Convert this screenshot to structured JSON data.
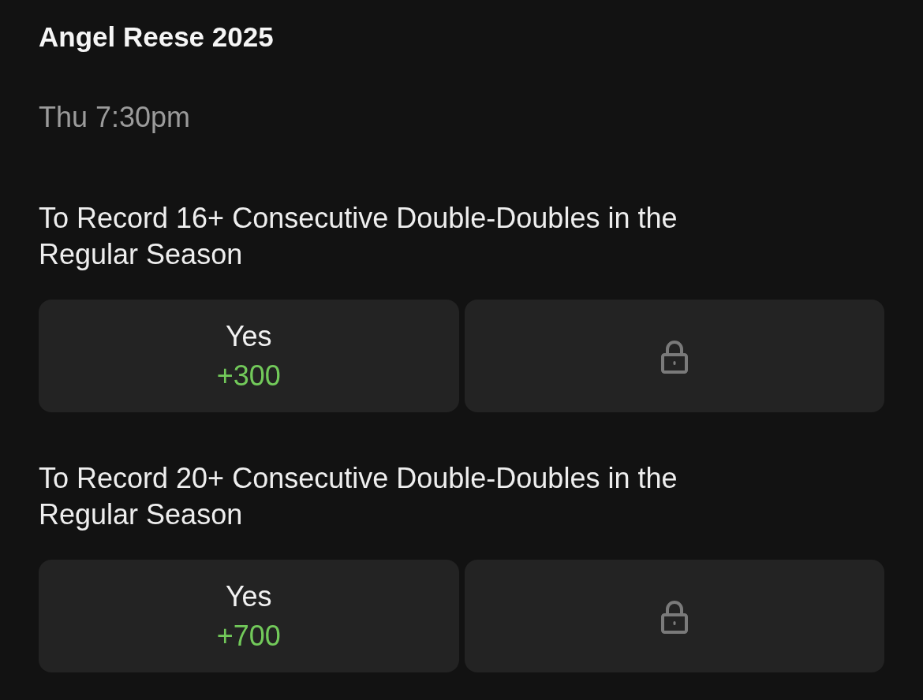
{
  "event": {
    "title": "Angel Reese 2025",
    "time": "Thu 7:30pm"
  },
  "markets": [
    {
      "question": "To Record 16+ Consecutive Double-Doubles in the Regular Season",
      "outcomes": [
        {
          "kind": "price",
          "label": "Yes",
          "odds": "+300"
        },
        {
          "kind": "locked"
        }
      ]
    },
    {
      "question": "To Record 20+ Consecutive Double-Doubles in the Regular Season",
      "outcomes": [
        {
          "kind": "price",
          "label": "Yes",
          "odds": "+700"
        },
        {
          "kind": "locked"
        }
      ]
    }
  ]
}
